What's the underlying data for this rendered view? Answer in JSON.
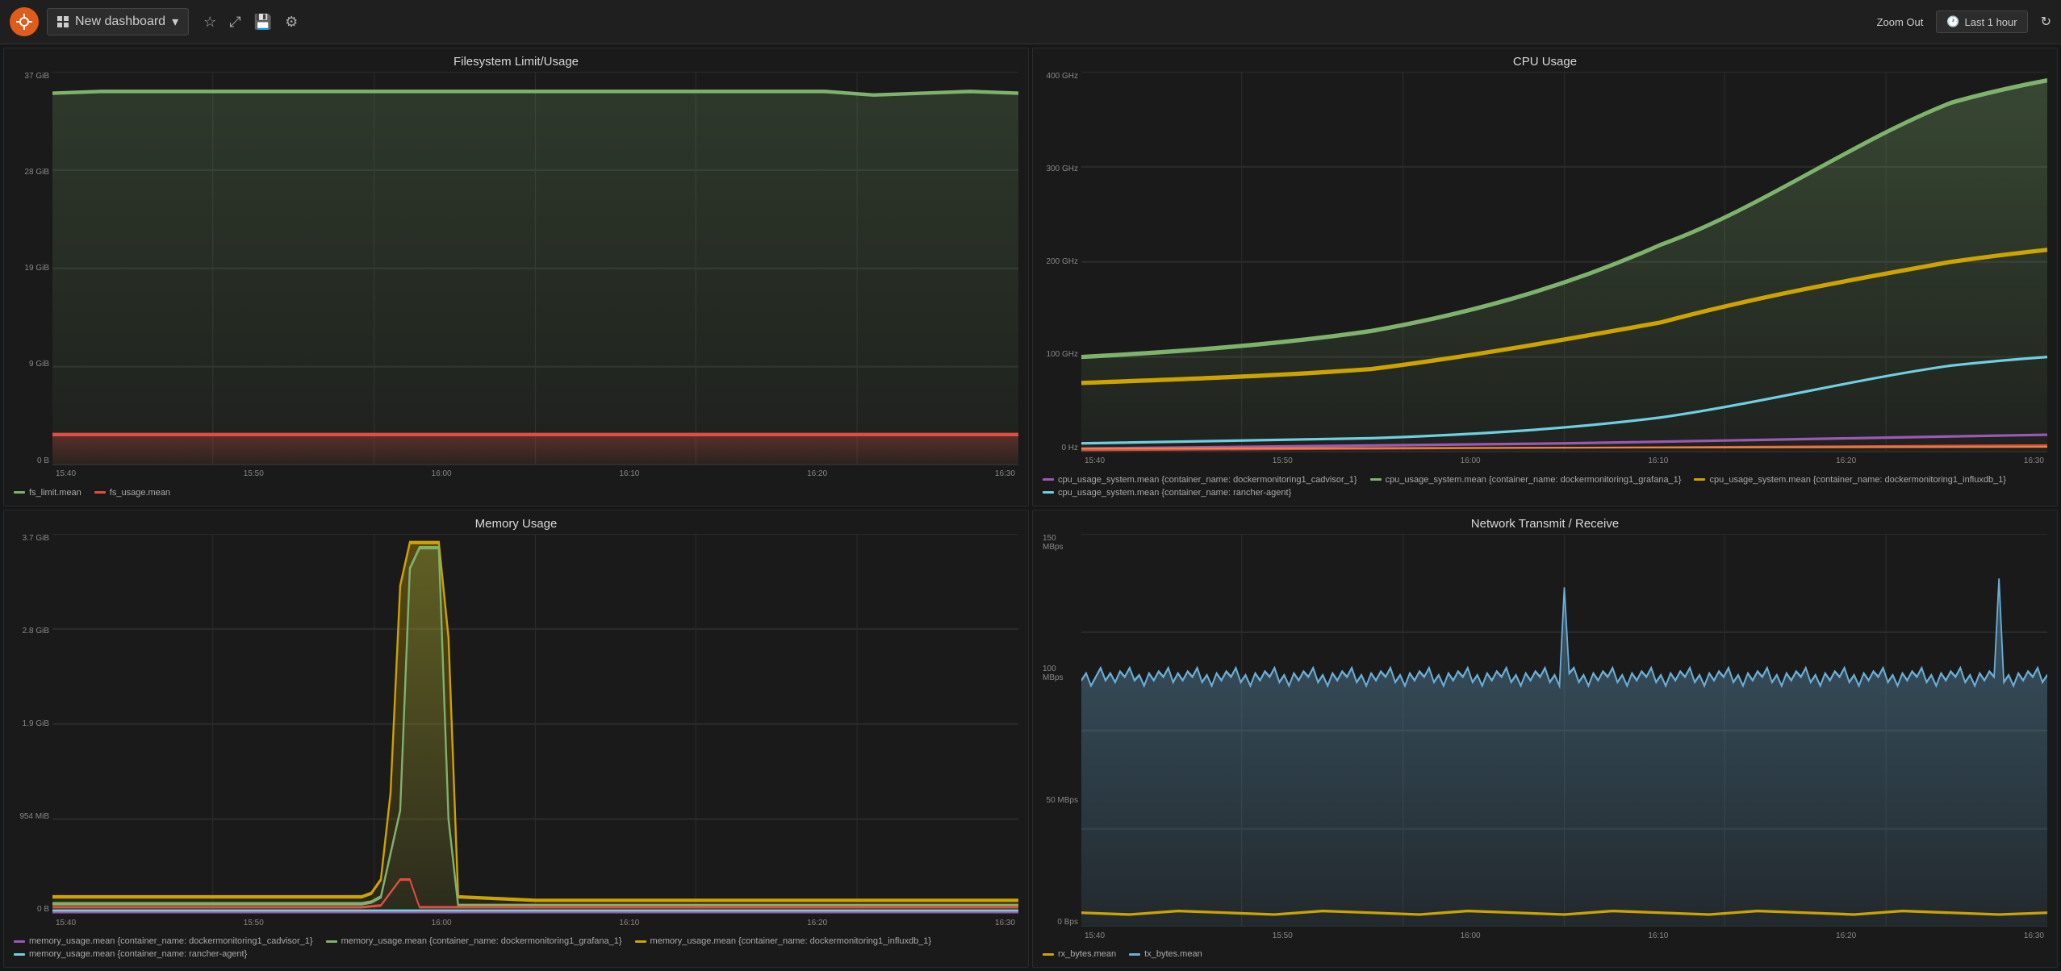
{
  "topbar": {
    "logo_symbol": "☀",
    "dashboard_title": "New dashboard",
    "dropdown_arrow": "▾",
    "star_icon": "★",
    "share_icon": "⤢",
    "save_icon": "💾",
    "settings_icon": "⚙",
    "zoom_out_label": "Zoom Out",
    "time_label": "Last 1 hour",
    "clock_icon": "🕐",
    "refresh_icon": "↻"
  },
  "panels": {
    "filesystem": {
      "title": "Filesystem Limit/Usage",
      "y_labels": [
        "37 GiB",
        "28 GiB",
        "19 GiB",
        "9 GiB",
        "0 B"
      ],
      "x_labels": [
        "15:40",
        "15:50",
        "16:00",
        "16:10",
        "16:20",
        "16:30"
      ],
      "legend": [
        {
          "label": "fs_limit.mean",
          "color": "#7eb26d"
        },
        {
          "label": "fs_usage.mean",
          "color": "#e24d42"
        }
      ]
    },
    "cpu": {
      "title": "CPU Usage",
      "y_labels": [
        "400 GHz",
        "300 GHz",
        "200 GHz",
        "100 GHz",
        "0 Hz"
      ],
      "x_labels": [
        "15:40",
        "15:50",
        "16:00",
        "16:10",
        "16:20",
        "16:30"
      ],
      "legend": [
        {
          "label": "cpu_usage_system.mean {container_name: dockermonitoring1_cadvisor_1}",
          "color": "#9b59b6"
        },
        {
          "label": "cpu_usage_system.mean {container_name: dockermonitoring1_grafana_1}",
          "color": "#7eb26d"
        },
        {
          "label": "cpu_usage_system.mean {container_name: dockermonitoring1_influxdb_1}",
          "color": "#cca300"
        },
        {
          "label": "cpu_usage_system.mean {container_name: rancher-agent}",
          "color": "#6ed0e0"
        }
      ]
    },
    "memory": {
      "title": "Memory Usage",
      "y_labels": [
        "3.7 GiB",
        "2.8 GiB",
        "1.9 GiB",
        "954 MiB",
        "0 B"
      ],
      "x_labels": [
        "15:40",
        "15:50",
        "16:00",
        "16:10",
        "16:20",
        "16:30"
      ],
      "legend": [
        {
          "label": "memory_usage.mean {container_name: dockermonitoring1_cadvisor_1}",
          "color": "#9b59b6"
        },
        {
          "label": "memory_usage.mean {container_name: dockermonitoring1_grafana_1}",
          "color": "#7eb26d"
        },
        {
          "label": "memory_usage.mean {container_name: dockermonitoring1_influxdb_1}",
          "color": "#cca300"
        },
        {
          "label": "memory_usage.mean {container_name: rancher-agent}",
          "color": "#6ed0e0"
        }
      ]
    },
    "network": {
      "title": "Network Transmit / Receive",
      "y_labels": [
        "150 MBps",
        "100 MBps",
        "50 MBps",
        "0 Bps"
      ],
      "x_labels": [
        "15:40",
        "15:50",
        "16:00",
        "16:10",
        "16:20",
        "16:30"
      ],
      "legend": [
        {
          "label": "rx_bytes.mean",
          "color": "#cca300"
        },
        {
          "label": "tx_bytes.mean",
          "color": "#6baed6"
        }
      ]
    }
  }
}
